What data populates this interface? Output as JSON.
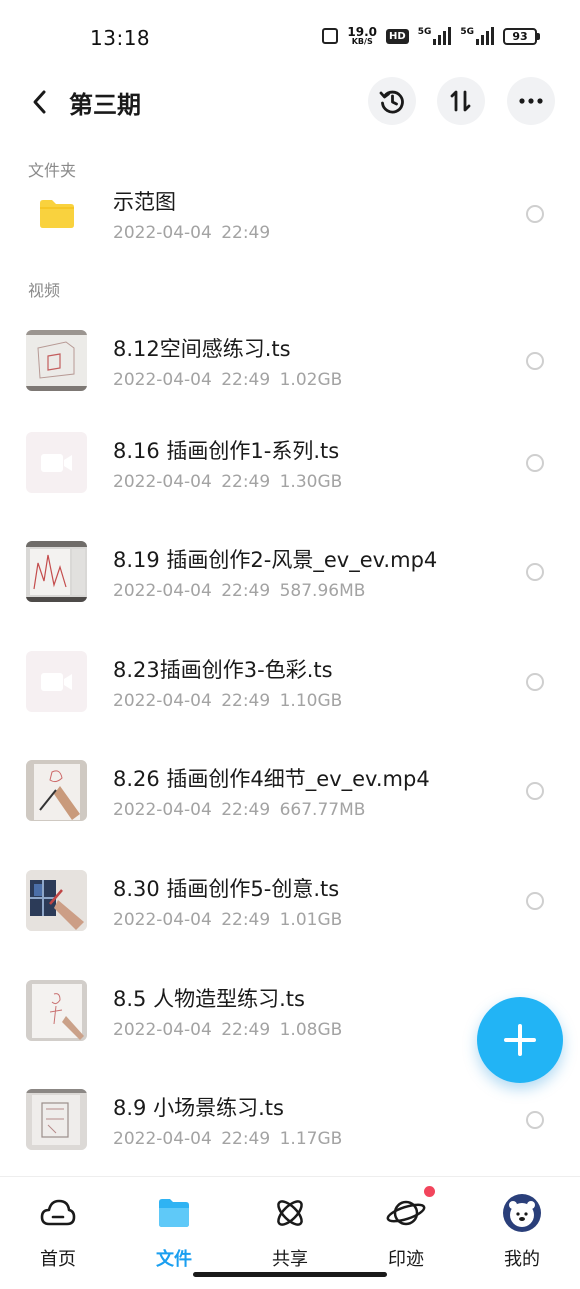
{
  "status_bar": {
    "time": "13:18",
    "speed_value": "19.0",
    "speed_unit": "KB/S",
    "hd_label": "HD",
    "net1_label": "5G",
    "net2_label": "5G",
    "battery": "93"
  },
  "header": {
    "title": "第三期",
    "icons": [
      "back-icon",
      "history-icon",
      "sort-icon",
      "more-icon"
    ]
  },
  "sections": {
    "folders_label": "文件夹",
    "videos_label": "视频"
  },
  "folders": [
    {
      "name": "示范图",
      "meta": "2022-04-04  22:49"
    }
  ],
  "videos": [
    {
      "name": "8.12空间感练习.ts",
      "meta": "2022-04-04  22:49  1.02GB",
      "thumb": "photo"
    },
    {
      "name": "8.16 插画创作1-系列.ts",
      "meta": "2022-04-04  22:49  1.30GB",
      "thumb": "placeholder"
    },
    {
      "name": "8.19 插画创作2-风景_ev_ev.mp4",
      "meta": "2022-04-04  22:49  587.96MB",
      "thumb": "photo"
    },
    {
      "name": "8.23插画创作3-色彩.ts",
      "meta": "2022-04-04  22:49  1.10GB",
      "thumb": "placeholder"
    },
    {
      "name": "8.26 插画创作4细节_ev_ev.mp4",
      "meta": "2022-04-04  22:49  667.77MB",
      "thumb": "photo"
    },
    {
      "name": "8.30 插画创作5-创意.ts",
      "meta": "2022-04-04  22:49  1.01GB",
      "thumb": "photo"
    },
    {
      "name": "8.5 人物造型练习.ts",
      "meta": "2022-04-04  22:49  1.08GB",
      "thumb": "photo"
    },
    {
      "name": "8.9 小场景练习.ts",
      "meta": "2022-04-04  22:49  1.17GB",
      "thumb": "photo"
    }
  ],
  "fab": {
    "icon": "plus-icon"
  },
  "bottom_nav": {
    "items": [
      {
        "label": "首页",
        "icon": "cloud-icon"
      },
      {
        "label": "文件",
        "icon": "folder-icon"
      },
      {
        "label": "共享",
        "icon": "atom-icon"
      },
      {
        "label": "印迹",
        "icon": "planet-icon"
      },
      {
        "label": "我的",
        "icon": "avatar-icon"
      }
    ],
    "active_index": 1
  },
  "colors": {
    "accent": "#1a9ff0",
    "fab": "#22b4f5",
    "folder": "#f9d23e",
    "badge": "#f2455c",
    "secondary_text": "#a3a3a3"
  }
}
